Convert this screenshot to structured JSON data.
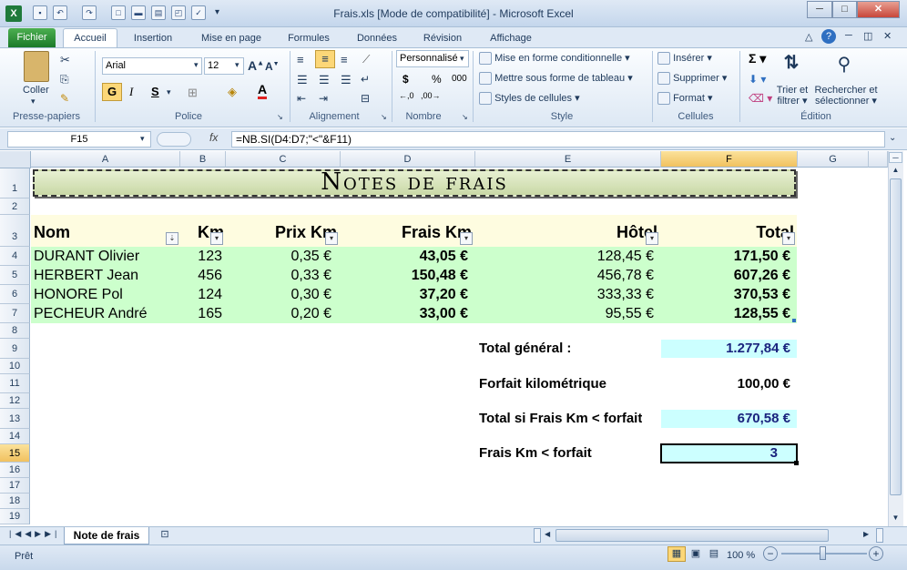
{
  "window": {
    "title": "Frais.xls  [Mode de compatibilité]  -  Microsoft Excel"
  },
  "tabs": [
    "Fichier",
    "Accueil",
    "Insertion",
    "Mise en page",
    "Formules",
    "Données",
    "Révision",
    "Affichage"
  ],
  "ribbon": {
    "clipboard": {
      "paste": "Coller",
      "label": "Presse-papiers"
    },
    "font": {
      "name": "Arial",
      "size": "12",
      "bold": "G",
      "italic": "I",
      "underline": "S",
      "label": "Police"
    },
    "alignment": {
      "label": "Alignement"
    },
    "number": {
      "format": "Personnalisé",
      "currency": "$",
      "percent": "%",
      "thousands": "000",
      "label": "Nombre"
    },
    "styles": {
      "conditional": "Mise en forme conditionnelle",
      "table": "Mettre sous forme de tableau",
      "cell_styles": "Styles de cellules",
      "label": "Style"
    },
    "cells": {
      "insert": "Insérer",
      "delete": "Supprimer",
      "format": "Format",
      "label": "Cellules"
    },
    "editing": {
      "sort": "Trier et filtrer",
      "find": "Rechercher et sélectionner",
      "sort_l1": "Trier et",
      "sort_l2": "filtrer",
      "find_l1": "Rechercher et",
      "find_l2": "sélectionner",
      "label": "Édition"
    }
  },
  "formula_bar": {
    "name_box": "F15",
    "fx": "fx",
    "formula": "=NB.SI(D4:D7;\"<\"&F11)"
  },
  "columns": [
    "A",
    "B",
    "C",
    "D",
    "E",
    "F",
    "G"
  ],
  "rows": [
    "1",
    "2",
    "3",
    "4",
    "5",
    "6",
    "7",
    "8",
    "9",
    "10",
    "11",
    "12",
    "13",
    "14",
    "15",
    "16",
    "17",
    "18",
    "19"
  ],
  "sheet": {
    "title": "Notes de frais",
    "headers": {
      "nom": "Nom",
      "km": "Km",
      "prix": "Prix Km",
      "frais": "Frais Km",
      "hotel": "Hôtel",
      "total": "Total"
    },
    "data": [
      {
        "nom": "DURANT Olivier",
        "km": "123",
        "prix": "0,35 €",
        "frais": "43,05 €",
        "hotel": "128,45 €",
        "total": "171,50 €"
      },
      {
        "nom": "HERBERT Jean",
        "km": "456",
        "prix": "0,33 €",
        "frais": "150,48 €",
        "hotel": "456,78 €",
        "total": "607,26 €"
      },
      {
        "nom": "HONORE Pol",
        "km": "124",
        "prix": "0,30 €",
        "frais": "37,20 €",
        "hotel": "333,33 €",
        "total": "370,53 €"
      },
      {
        "nom": "PECHEUR André",
        "km": "165",
        "prix": "0,20 €",
        "frais": "33,00 €",
        "hotel": "95,55 €",
        "total": "128,55 €"
      }
    ],
    "summary": [
      {
        "label": "Total général :",
        "value": "1.277,84 €"
      },
      {
        "label": "Forfait kilométrique",
        "value": "100,00 €"
      },
      {
        "label": "Total si Frais Km < forfait",
        "value": "670,58 €"
      },
      {
        "label": "Frais Km < forfait",
        "value": "3"
      }
    ]
  },
  "sheet_tab": "Note de frais",
  "status": {
    "ready": "Prêt",
    "zoom": "100 %"
  },
  "colors": {
    "header_fill": "#fefce0",
    "data_fill": "#ccffcc",
    "summary_fill": "#ccffff",
    "selected": "#f1c15f"
  }
}
